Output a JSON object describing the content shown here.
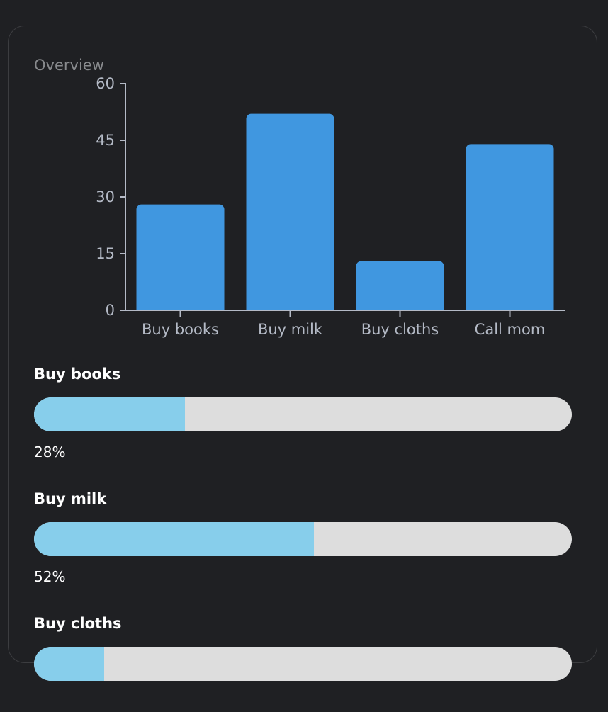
{
  "overview_label": "Overview",
  "colors": {
    "background": "#1f2023",
    "bar": "#4097e0",
    "axis": "#b4bac6",
    "progress_fill": "#87ceeb",
    "progress_track": "#dddddd"
  },
  "chart_data": {
    "type": "bar",
    "categories": [
      "Buy books",
      "Buy milk",
      "Buy cloths",
      "Call mom"
    ],
    "values": [
      28,
      52,
      13,
      44
    ],
    "ylim": [
      0,
      60
    ],
    "yticks": [
      "0",
      "15",
      "30",
      "45",
      "60"
    ],
    "grid": false
  },
  "tasks": [
    {
      "name": "Buy books",
      "percent": 28,
      "percent_label": "28%"
    },
    {
      "name": "Buy milk",
      "percent": 52,
      "percent_label": "52%"
    },
    {
      "name": "Buy cloths",
      "percent": 13,
      "percent_label": ""
    }
  ]
}
